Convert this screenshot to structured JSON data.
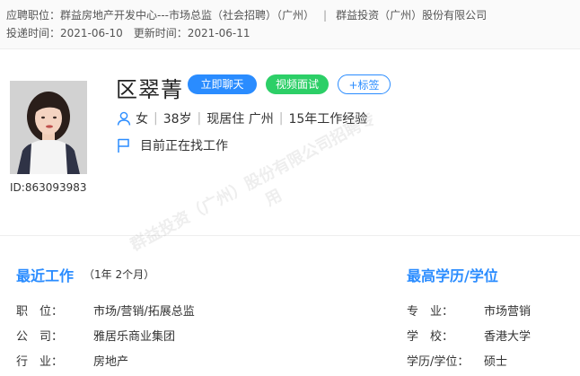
{
  "header": {
    "position_label": "应聘职位：",
    "position_value": "群益房地产开发中心---市场总监（社会招聘）（广州）",
    "company": "群益投资（广州）股份有限公司",
    "delivered_label": "投递时间：",
    "delivered_value": "2021-06-10",
    "updated_label": "更新时间：",
    "updated_value": "2021-06-11"
  },
  "profile": {
    "name": "区翠菁",
    "id_text": "ID:863093983",
    "gender": "女",
    "age": "38岁",
    "residence": "现居住 广州",
    "experience": "15年工作经验",
    "status": "目前正在找工作"
  },
  "actions": {
    "chat": "立即聊天",
    "video": "视频面试",
    "tag": "+标签"
  },
  "recent_work": {
    "title": "最近工作",
    "duration": "（1年 2个月）",
    "rows": [
      {
        "label": "职　位：",
        "value": "市场/营销/拓展总监"
      },
      {
        "label": "公　司：",
        "value": "雅居乐商业集团"
      },
      {
        "label": "行　业：",
        "value": "房地产"
      }
    ]
  },
  "education": {
    "title": "最高学历/学位",
    "rows": [
      {
        "label": "专　业：",
        "value": "市场营销"
      },
      {
        "label": "学　校：",
        "value": "香港大学"
      },
      {
        "label": "学历/学位：",
        "value": "硕士"
      }
    ]
  },
  "watermark": {
    "line_a": "群益投资（广州）股份有限公司招聘专",
    "line_b": "用"
  }
}
